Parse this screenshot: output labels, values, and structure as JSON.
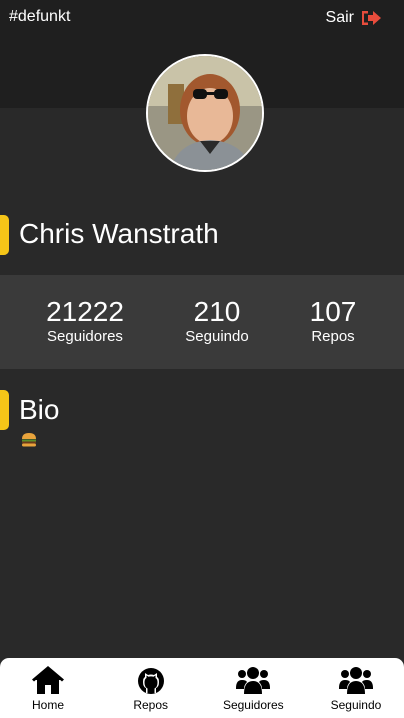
{
  "header": {
    "username": "#defunkt",
    "logout_label": "Sair"
  },
  "profile": {
    "name": "Chris Wanstrath"
  },
  "stats": [
    {
      "value": "21222",
      "label": "Seguidores"
    },
    {
      "value": "210",
      "label": "Seguindo"
    },
    {
      "value": "107",
      "label": "Repos"
    }
  ],
  "bio": {
    "title": "Bio",
    "content_icon": "hamburger-emoji"
  },
  "tabbar": {
    "items": [
      {
        "label": "Home",
        "icon": "home-icon"
      },
      {
        "label": "Repos",
        "icon": "github-icon"
      },
      {
        "label": "Seguidores",
        "icon": "users-icon"
      },
      {
        "label": "Seguindo",
        "icon": "users-icon"
      }
    ]
  },
  "colors": {
    "background": "#292929",
    "header_band": "#1f1f1f",
    "stats_band": "#3a3a3a",
    "accent": "#f5c518",
    "logout_icon": "#e74c3c",
    "tabbar": "#ffffff"
  }
}
